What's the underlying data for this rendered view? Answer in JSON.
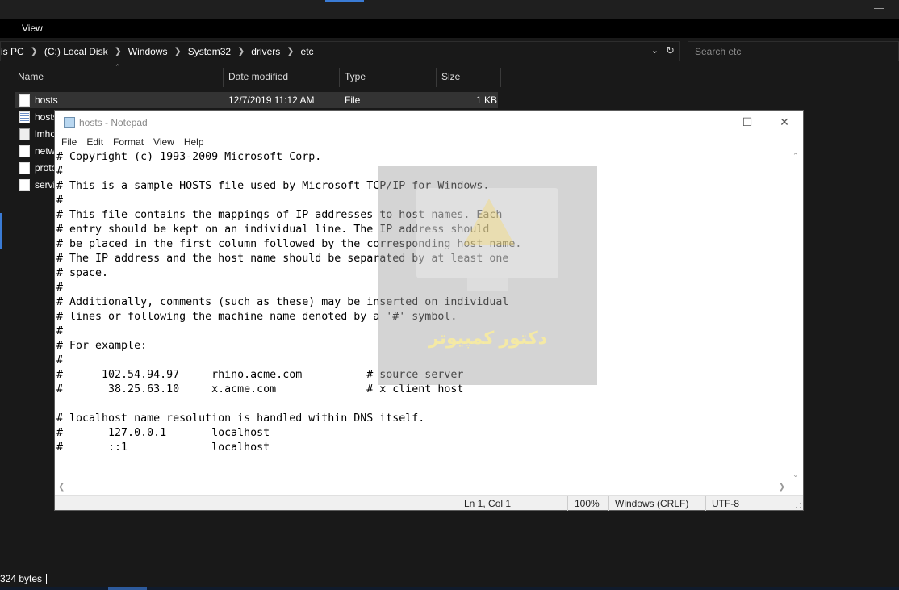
{
  "explorer": {
    "menu_view": "View",
    "breadcrumbs": [
      "is PC",
      "(C:) Local Disk",
      "Windows",
      "System32",
      "drivers",
      "etc"
    ],
    "search_placeholder": "Search etc",
    "columns": {
      "name": "Name",
      "date": "Date modified",
      "type": "Type",
      "size": "Size"
    },
    "selected_row": {
      "name": "hosts",
      "date": "12/7/2019 11:12 AM",
      "type": "File",
      "size": "1 KB"
    },
    "other_files": [
      "hosts",
      "lmho",
      "netw",
      "proto",
      "servi"
    ],
    "status": "324 bytes"
  },
  "notepad": {
    "title": "hosts - Notepad",
    "menu": [
      "File",
      "Edit",
      "Format",
      "View",
      "Help"
    ],
    "lines": [
      "# Copyright (c) 1993-2009 Microsoft Corp.",
      "#",
      "# This is a sample HOSTS file used by Microsoft TCP/IP for Windows.",
      "#",
      "# This file contains the mappings of IP addresses to host names. Each",
      "# entry should be kept on an individual line. The IP address should",
      "# be placed in the first column followed by the corresponding host name.",
      "# The IP address and the host name should be separated by at least one",
      "# space.",
      "#",
      "# Additionally, comments (such as these) may be inserted on individual",
      "# lines or following the machine name denoted by a '#' symbol.",
      "#",
      "# For example:",
      "#",
      "#      102.54.94.97     rhino.acme.com          # source server",
      "#       38.25.63.10     x.acme.com              # x client host",
      "",
      "# localhost name resolution is handled within DNS itself.",
      "#       127.0.0.1       localhost",
      "#       ::1             localhost"
    ],
    "status": {
      "position": "Ln 1, Col 1",
      "zoom": "100%",
      "line_ending": "Windows (CRLF)",
      "encoding": "UTF-8"
    }
  },
  "watermark": {
    "text": "دکتور کمپیوتر"
  }
}
